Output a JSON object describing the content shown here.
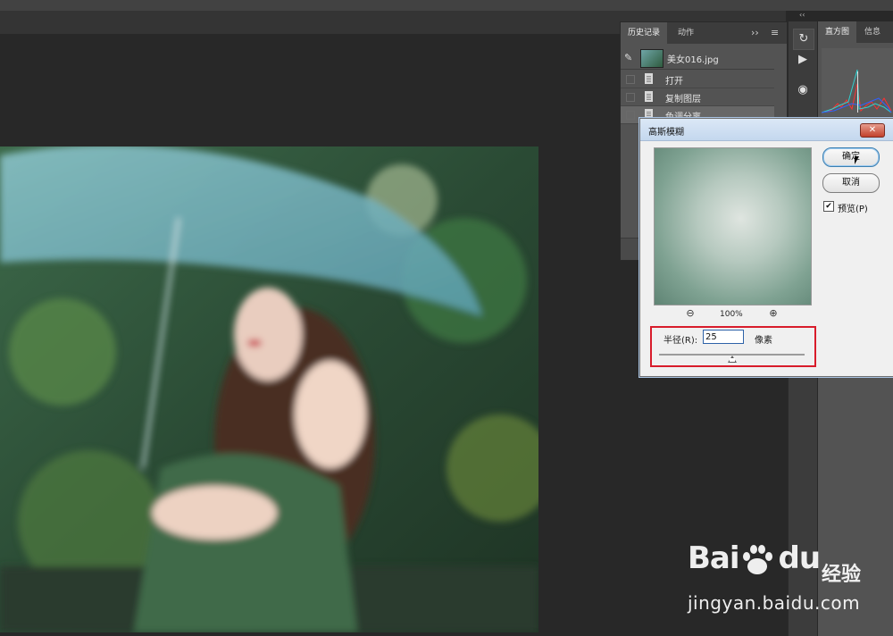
{
  "history_panel": {
    "tabs": [
      "历史记录",
      "动作"
    ],
    "snapshot_name": "美女016.jpg",
    "items": [
      "打开",
      "复制图层",
      "色调分离"
    ]
  },
  "right_panel": {
    "tabs": [
      "直方图",
      "信息"
    ]
  },
  "dialog": {
    "title": "高斯模糊",
    "ok_label": "确定",
    "cancel_label": "取消",
    "preview_label": "预览(P)",
    "preview_checked": true,
    "zoom_level": "100%",
    "radius_label": "半径(R):",
    "radius_value": "25",
    "unit_label": "像素",
    "slider_fraction": 0.5,
    "close_symbol": "✕"
  },
  "icons": {
    "zoom_out": "zoom-out-icon",
    "zoom_in": "zoom-in-icon",
    "play": "play-icon",
    "history_brush": "history-brush-icon",
    "menu": "panel-menu-icon"
  },
  "watermark": {
    "logo_left": "Bai",
    "logo_right": "du",
    "brand": "经验",
    "url": "jingyan.baidu.com"
  },
  "colors": {
    "highlight": "#d81c2b",
    "panel_bg": "#535353",
    "workspace_bg": "#282828"
  }
}
